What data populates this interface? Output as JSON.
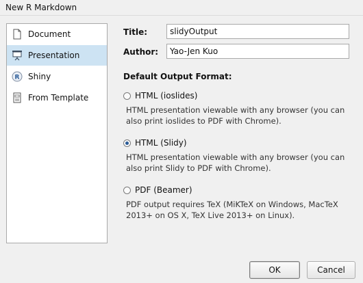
{
  "window": {
    "title": "New R Markdown"
  },
  "sidebar": {
    "items": [
      {
        "label": "Document",
        "icon": "document-icon",
        "selected": false
      },
      {
        "label": "Presentation",
        "icon": "presentation-icon",
        "selected": true
      },
      {
        "label": "Shiny",
        "icon": "shiny-r-icon",
        "selected": false
      },
      {
        "label": "From Template",
        "icon": "template-icon",
        "selected": false
      }
    ]
  },
  "form": {
    "title_label": "Title:",
    "title_value": "slidyOutput",
    "author_label": "Author:",
    "author_value": "Yao-Jen Kuo"
  },
  "output_format": {
    "heading": "Default Output Format:",
    "options": [
      {
        "label": "HTML (ioslides)",
        "checked": false,
        "description": "HTML presentation viewable with any browser (you can also print ioslides to PDF with Chrome)."
      },
      {
        "label": "HTML (Slidy)",
        "checked": true,
        "description": "HTML presentation viewable with any browser (you can also print Slidy to PDF with Chrome)."
      },
      {
        "label": "PDF (Beamer)",
        "checked": false,
        "description": "PDF output requires TeX (MiKTeX on Windows, MacTeX 2013+ on OS X, TeX Live 2013+ on Linux)."
      }
    ]
  },
  "buttons": {
    "ok": "OK",
    "cancel": "Cancel"
  },
  "colors": {
    "selection": "#cde3f3",
    "background": "#f0f0f0",
    "radio_dot": "#2a5b97"
  }
}
